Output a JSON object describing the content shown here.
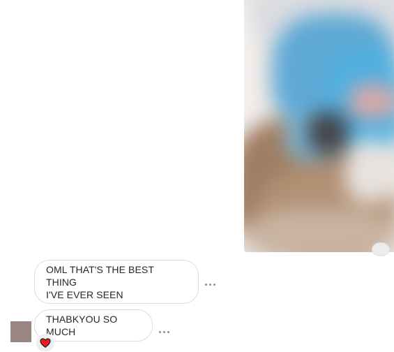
{
  "messages": [
    {
      "text": "OML THAT'S THE BEST THING\nI'VE EVER SEEN",
      "more_icon": "ellipsis-icon"
    },
    {
      "text": "THABKYOU SO MUCH",
      "more_icon": "ellipsis-icon",
      "reaction_icon": "heart-icon"
    }
  ],
  "colors": {
    "bubble_border": "#dbdbdb",
    "text": "#262626",
    "heart": "#ed1c24",
    "avatar": "#9a8682"
  },
  "shared_image": {
    "blurred": true
  }
}
